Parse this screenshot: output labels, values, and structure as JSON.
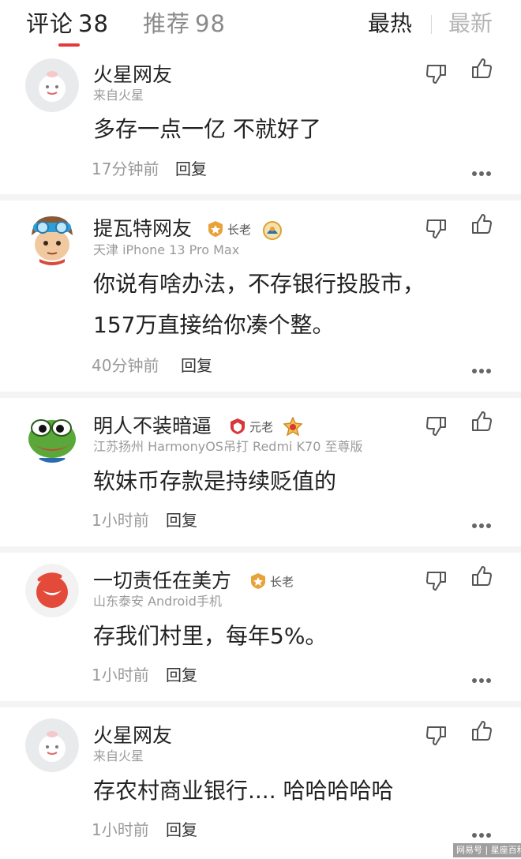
{
  "header": {
    "tab_comments": {
      "label": "评论",
      "count": "38"
    },
    "tab_recommend": {
      "label": "推荐",
      "count": "98"
    },
    "sort_hot": "最热",
    "sort_new": "最新"
  },
  "comments": [
    {
      "username": "火星网友",
      "meta": "来自火星",
      "content": "多存一点一亿 不就好了",
      "time": "17分钟前",
      "reply": "回复"
    },
    {
      "username": "提瓦特网友",
      "badge": "长老",
      "meta": "天津  iPhone 13 Pro Max",
      "content": "你说有啥办法，不存银行投股市，157万直接给你凑个整。",
      "time": "40分钟前",
      "reply": "回复"
    },
    {
      "username": "明人不装暗逼",
      "badge": "元老",
      "meta": "江苏扬州  HarmonyOS吊打  Redmi K70 至尊版",
      "content": "软妹币存款是持续贬值的",
      "time": "1小时前",
      "reply": "回复"
    },
    {
      "username": "一切责任在美方",
      "badge": "长老",
      "meta": "山东泰安  Android手机",
      "content": "存我们村里，每年5%。",
      "time": "1小时前",
      "reply": "回复"
    },
    {
      "username": "火星网友",
      "meta": "来自火星",
      "content": "存农村商业银行.... 哈哈哈哈哈",
      "time": "1小时前",
      "reply": "回复"
    }
  ],
  "watermark": "网易号 | 星座百科",
  "colors": {
    "accent": "#e33a3a",
    "text": "#222222",
    "muted": "#9a9a9a",
    "separator": "#f4f4f4"
  },
  "icons": [
    "thumbs-down-icon",
    "thumbs-up-icon",
    "more-icon",
    "level-badge-icon",
    "medal-icon"
  ]
}
